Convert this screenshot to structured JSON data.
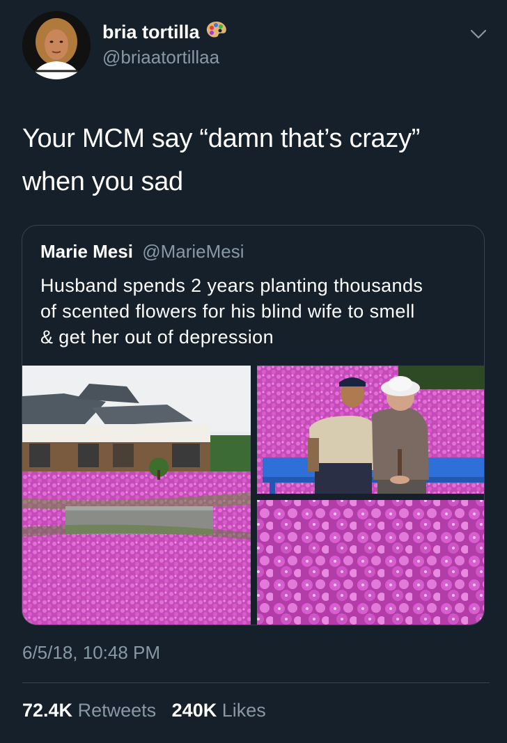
{
  "author": {
    "display_name": "bria tortilla",
    "handle": "@briaatortillaa",
    "badge_icon": "artist-palette-emoji"
  },
  "tweet": {
    "lines": [
      "Your MCM say “damn that’s crazy”",
      "when you sad"
    ]
  },
  "quoted_tweet": {
    "display_name": "Marie Mesi",
    "handle": "@MarieMesi",
    "lines": [
      "Husband spends 2 years planting thousands",
      "of scented flowers for his blind wife to smell",
      "& get her out of depression"
    ],
    "media": [
      "house-with-flower-field-photo",
      "elderly-couple-photo",
      "pink-flowers-closeup-photo"
    ]
  },
  "timestamp": "6/5/18, 10:48 PM",
  "stats": {
    "retweets_count": "72.4K",
    "retweets_label": "Retweets",
    "likes_count": "240K",
    "likes_label": "Likes"
  },
  "colors": {
    "background": "#15202b",
    "secondary_text": "#8899a6",
    "border": "#38444d",
    "flower_pink": "#d455c8"
  }
}
